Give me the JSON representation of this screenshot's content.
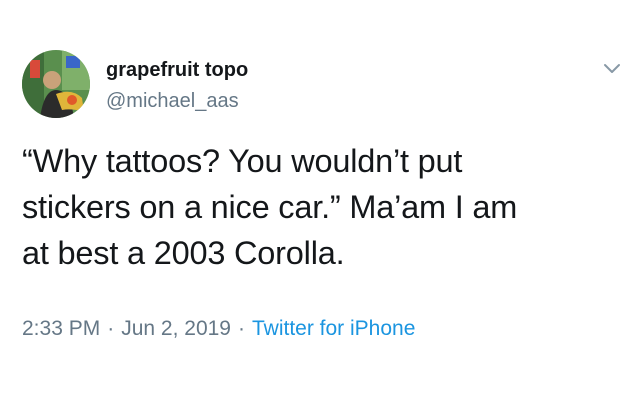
{
  "tweet": {
    "author": {
      "display_name": "grapefruit topo",
      "handle": "@michael_aas"
    },
    "text_lines": [
      "“Why tattoos? You wouldn’t put",
      "stickers on a nice car.” Ma’am I am",
      "at best a 2003 Corolla."
    ],
    "time": "2:33 PM",
    "separator": "·",
    "date": "Jun 2, 2019",
    "source": "Twitter for iPhone"
  },
  "icons": {
    "avatar": "avatar-photo",
    "menu": "chevron-down-icon"
  },
  "colors": {
    "text": "#14171a",
    "secondary": "#657786",
    "link": "#1b95e0",
    "background": "#ffffff"
  }
}
